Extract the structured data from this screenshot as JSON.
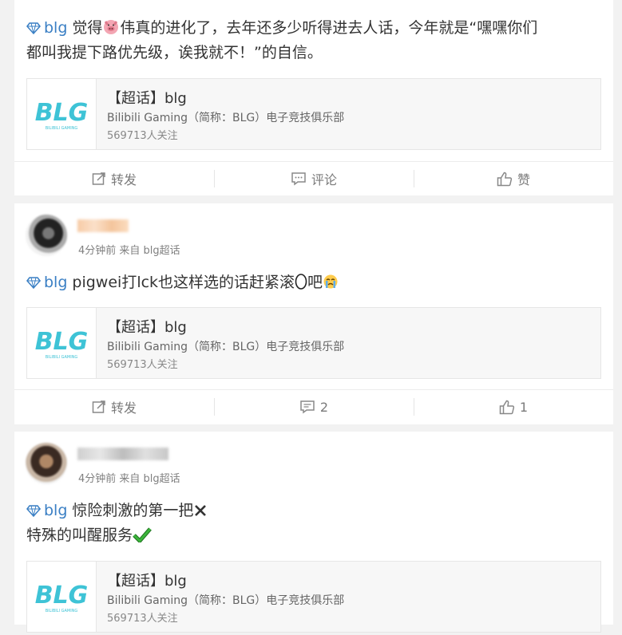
{
  "posts": [
    {
      "tag": "blg",
      "text_lines": [
        "觉得",
        "伟真的进化了，去年还多少听得进去人话，今年就是“嘿嘿你们",
        "都叫我提下路优先级，诶我就不！”的自信。"
      ],
      "emoji": "pig-face-icon",
      "topic": {
        "title": "【超话】blg",
        "subtitle": "Bilibili Gaming（简称：BLG）电子竞技俱乐部",
        "followers": "569713人关注",
        "logo_text": "BLG",
        "logo_subtext": "BILIBILI GAMING"
      },
      "actions": {
        "repost": "转发",
        "comment": "评论",
        "like": "赞"
      }
    },
    {
      "username": "",
      "meta": "4分钟前 来自 blg超话",
      "tag": "blg",
      "text": "pigwei打lck也这样选的话赶紧滚",
      "text_suffix": "吧",
      "topic": {
        "title": "【超话】blg",
        "subtitle": "Bilibili Gaming（简称：BLG）电子竞技俱乐部",
        "followers": "569713人关注",
        "logo_text": "BLG",
        "logo_subtext": "BILIBILI GAMING"
      },
      "actions": {
        "repost": "转发",
        "comment": "2",
        "like": "1"
      }
    },
    {
      "username": "",
      "meta": "4分钟前 来自 blg超话",
      "tag": "blg",
      "line1": "惊险刺激的第一把",
      "line2": "特殊的叫醒服务",
      "topic": {
        "title": "【超话】blg",
        "subtitle": "Bilibili Gaming（简称：BLG）电子竞技俱乐部",
        "followers": "569713人关注",
        "logo_text": "BLG",
        "logo_subtext": "BILIBILI GAMING"
      }
    }
  ],
  "colors": {
    "link": "#3a7fc4",
    "logo": "#3ec3d6",
    "check": "#3bb53b"
  }
}
